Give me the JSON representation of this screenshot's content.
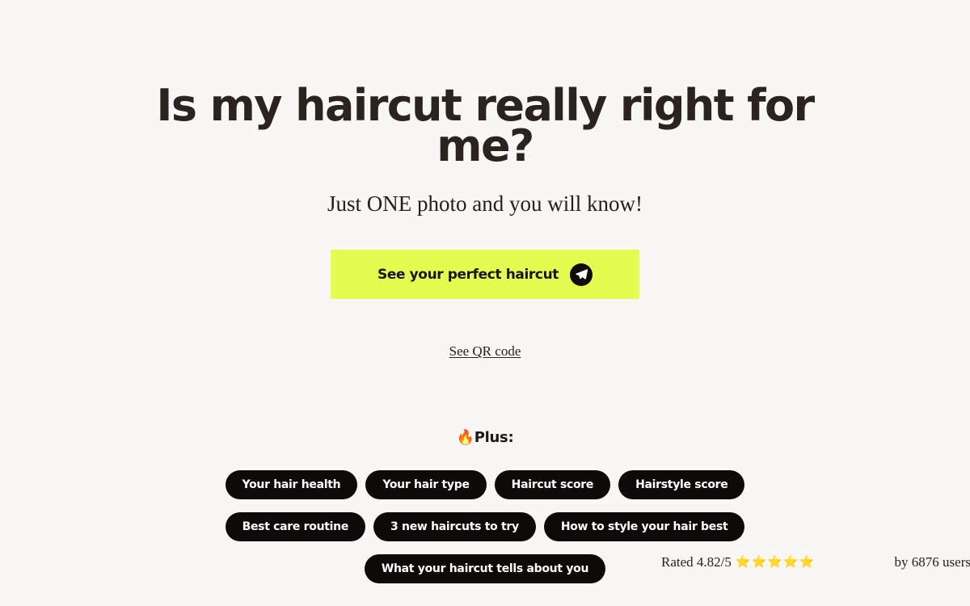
{
  "page": {
    "background_color": "#f8f7f4",
    "text_color": "#2b2320"
  },
  "hero": {
    "headline": "Is my haircut really right for me?",
    "subtitle": "Just ONE photo and you will know!"
  },
  "cta": {
    "label": "See your perfect haircut",
    "icon": "telegram-paper-plane-icon",
    "background_color": "#e4fb50",
    "text_color": "#191512"
  },
  "rating": {
    "score_text": "Rated 4.82/5",
    "score_value": "4.82",
    "max_value": "5",
    "stars": "⭐⭐⭐⭐⭐",
    "star_count": 5,
    "users_text": "by 6876 users",
    "users_count": "6876"
  },
  "qr": {
    "link_label": "See QR code"
  },
  "plus": {
    "fire_emoji": "🔥",
    "heading": "Plus:",
    "rows": [
      [
        {
          "label": "Your hair health"
        },
        {
          "label": "Your hair type"
        },
        {
          "label": "Haircut score"
        },
        {
          "label": "Hairstyle score"
        }
      ],
      [
        {
          "label": "Best care routine"
        },
        {
          "label": "3 new haircuts to try"
        },
        {
          "label": "How to style your hair best"
        }
      ],
      [
        {
          "label": "What your haircut tells about you"
        }
      ]
    ]
  }
}
